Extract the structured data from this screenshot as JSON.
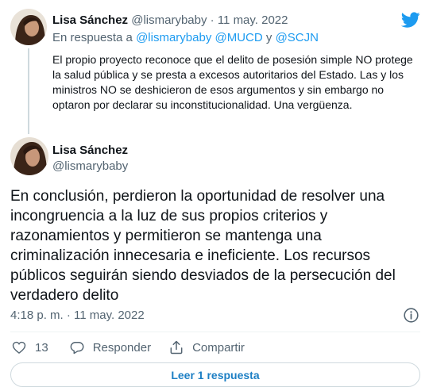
{
  "parent_tweet": {
    "author_name": "Lisa Sánchez",
    "author_handle": "@lismarybaby",
    "separator": "·",
    "date": "11 may. 2022",
    "reply_prefix": "En respuesta a",
    "reply_mentions": "@lismarybaby @MUCD",
    "reply_and": "y",
    "reply_last_mention": "@SCJN",
    "text": "El propio proyecto reconoce que el delito de posesión simple NO protege la salud pública y se presta a excesos autoritarios del Estado. Las y los ministros NO se deshicieron de esos argumentos y sin embargo no optaron por declarar su inconstitucionalidad. Una vergüenza."
  },
  "main_tweet": {
    "author_name": "Lisa Sánchez",
    "author_handle": "@lismarybaby",
    "text": "En conclusión, perdieron la oportunidad de resolver una incongruencia a la luz de sus propios criterios y razonamientos y permitieron se mantenga una criminalización innecesaria e ineficiente. Los recursos públicos seguirán siendo desviados de la persecución del verdadero delito",
    "time": "4:18 p. m.",
    "separator": "·",
    "date": "11 may. 2022"
  },
  "actions": {
    "like_count": "13",
    "reply_label": "Responder",
    "share_label": "Compartir"
  },
  "read_replies_label": "Leer 1 respuesta",
  "colors": {
    "twitter_blue": "#1d9bf0",
    "link_text": "#1d7fc4",
    "secondary_text": "#536471",
    "border": "#cfd9de"
  },
  "icons": [
    "twitter-bird-icon",
    "info-icon",
    "heart-icon",
    "reply-bubble-icon",
    "share-icon"
  ]
}
